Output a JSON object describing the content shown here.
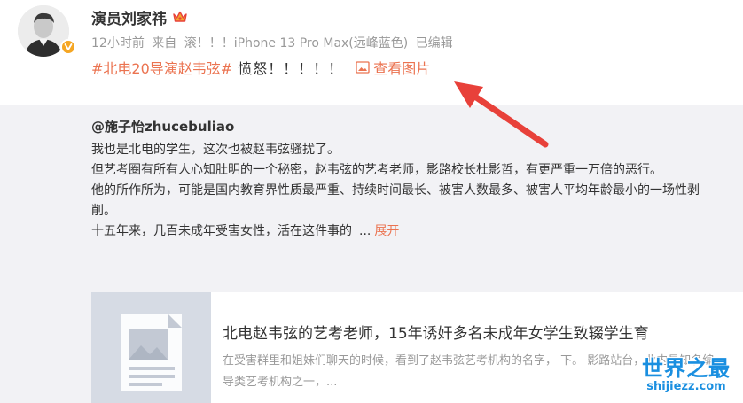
{
  "post": {
    "author_name": "演员刘家祎",
    "meta": {
      "time": "12小时前",
      "source_prefix": "来自",
      "source": "滚！！！iPhone 13 Pro Max(远峰蓝色)",
      "edited": "已编辑"
    },
    "hashtag": "#北电20导演赵韦弦#",
    "text": "愤怒！！！！！",
    "view_image_label": "查看图片"
  },
  "repost": {
    "author": "@施子怡zhucebuliao",
    "lines": [
      "我也是北电的学生，这次也被赵韦弦骚扰了。",
      "但艺考圈有所有人心知肚明的一个秘密，赵韦弦的艺考老师，影路校长杜影哲，有更严重一万倍的恶行。",
      "他的所作所为，可能是国内教育界性质最严重、持续时间最长、被害人数最多、被害人平均年龄最小的一场性剥削。",
      "十五年来，几百未成年受害女性，活在这件事的"
    ],
    "ellipsis": "...",
    "expand_label": "展开",
    "card": {
      "title": "北电赵韦弦的艺考老师，15年诱奸多名未成年女学生致辍学生育",
      "description": "在受害群里和姐妹们聊天的时候，看到了赵韦弦艺考机构的名字，                 下。 影路站台，业内最知名编导类艺考机构之一，..."
    }
  },
  "watermark": {
    "main": "世界之最",
    "sub": "shijiezz.com"
  },
  "colors": {
    "accent": "#eb7350",
    "meta_gray": "#999999",
    "repost_bg": "#f2f2f5",
    "verify_badge": "#f5a623",
    "arrow": "#e8413a",
    "watermark": "#1a8fe0"
  }
}
